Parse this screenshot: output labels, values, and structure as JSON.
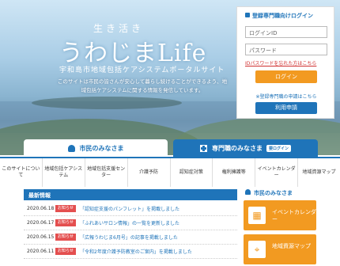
{
  "hero": {
    "subtitle": "生き活き",
    "title": "うわじまLife",
    "caption": "宇和島市地域包括ケアシステムポータルサイト",
    "description": "このサイトは市民の皆さんが安心して暮らし続けることができるよう、地域包括ケアシステムに関する情報を発信しています。"
  },
  "login": {
    "heading": "登録専門職向けログイン",
    "id_placeholder": "ログインID",
    "password_placeholder": "パスワード",
    "forgot": "IDパスワードを忘れた方はこちら",
    "login_button": "ログイン",
    "note": "※登録専門職の申請はこちら",
    "apply_button": "利用申請"
  },
  "tabs": {
    "citizen": "市民のみなさま",
    "pro": "専門職のみなさま",
    "pro_badge": "要ログイン"
  },
  "nav": [
    "このサイトについて",
    "地域包括ケアシステム",
    "地域包括支援センター",
    "介護予防",
    "認知症対策",
    "権利擁護等",
    "イベントカレンダー",
    "地域資源マップ"
  ],
  "news": {
    "heading": "最新情報",
    "items": [
      {
        "date": "2020.06.18",
        "badge": "お知らせ",
        "title": "「認知症支援のパンフレット」を掲載しました"
      },
      {
        "date": "2020.06.17",
        "badge": "お知らせ",
        "title": "「ふれあいサロン情報」の一覧を更新しました"
      },
      {
        "date": "2020.06.15",
        "badge": "お知らせ",
        "title": "「広報うわじま6月号」の記事を掲載しました"
      },
      {
        "date": "2020.06.11",
        "badge": "お知らせ",
        "title": "「令和2年度介護予防教室のご案内」を掲載しました"
      }
    ]
  },
  "side": {
    "heading": "市民のみなさま",
    "cards": [
      {
        "label": "イベントカレンダー",
        "icon": "calendar-icon"
      },
      {
        "label": "地域資源マップ",
        "icon": "map-icon"
      }
    ]
  },
  "colors": {
    "primary": "#1f74b9",
    "accent": "#f29a21",
    "badge": "#e44f4f"
  }
}
